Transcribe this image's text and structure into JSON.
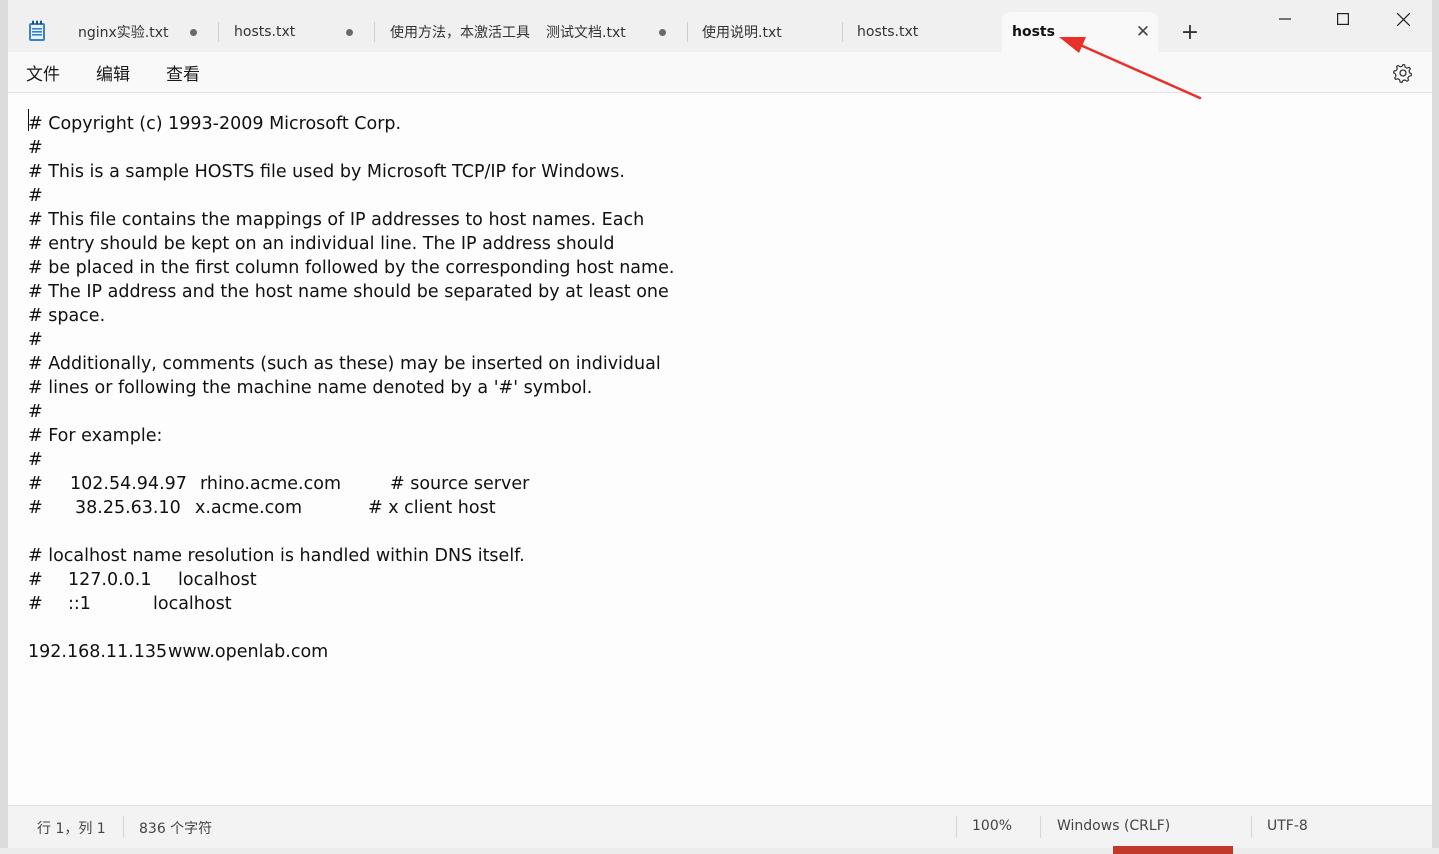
{
  "tabs": [
    {
      "label": "nginx实验.txt",
      "unsaved": true
    },
    {
      "label": "hosts.txt",
      "unsaved": true
    },
    {
      "label": "使用方法，本激活工具",
      "unsaved": false
    },
    {
      "label": "测试文档.txt",
      "unsaved": true
    },
    {
      "label": "使用说明.txt",
      "unsaved": false
    },
    {
      "label": "hosts.txt",
      "unsaved": false
    },
    {
      "label": "hosts",
      "active": true
    }
  ],
  "window_controls": {
    "new_tab": "+",
    "close_tab": "✕"
  },
  "menu": {
    "file": "文件",
    "edit": "编辑",
    "view": "查看"
  },
  "editor": {
    "lines": [
      [
        "# Copyright (c) 1993-2009 Microsoft Corp."
      ],
      [
        "#"
      ],
      [
        "# This is a sample HOSTS file used by Microsoft TCP/IP for Windows."
      ],
      [
        "#"
      ],
      [
        "# This file contains the mappings of IP addresses to host names. Each"
      ],
      [
        "# entry should be kept on an individual line. The IP address should"
      ],
      [
        "# be placed in the first column followed by the corresponding host name."
      ],
      [
        "# The IP address and the host name should be separated by at least one"
      ],
      [
        "# space."
      ],
      [
        "#"
      ],
      [
        "# Additionally, comments (such as these) may be inserted on individual"
      ],
      [
        "# lines or following the machine name denoted by a '#' symbol."
      ],
      [
        "#"
      ],
      [
        "# For example:"
      ],
      [
        "#"
      ],
      [
        "#",
        "102.54.94.97",
        "rhino.acme.com",
        "# source server"
      ],
      [
        "#",
        "38.25.63.10",
        "x.acme.com",
        "# x client host"
      ],
      [
        ""
      ],
      [
        "# localhost name resolution is handled within DNS itself."
      ],
      [
        "#",
        "127.0.0.1",
        "localhost"
      ],
      [
        "#",
        "::1",
        "localhost"
      ],
      [
        ""
      ],
      [
        "192.168.11.135",
        "www.openlab.com"
      ]
    ]
  },
  "status": {
    "position": "行 1，列 1",
    "chars": "836 个字符",
    "zoom": "100%",
    "line_ending": "Windows (CRLF)",
    "encoding": "UTF-8"
  },
  "colors": {
    "annotation_arrow": "#e8312a",
    "accent_icon": "#2b6cb0"
  }
}
